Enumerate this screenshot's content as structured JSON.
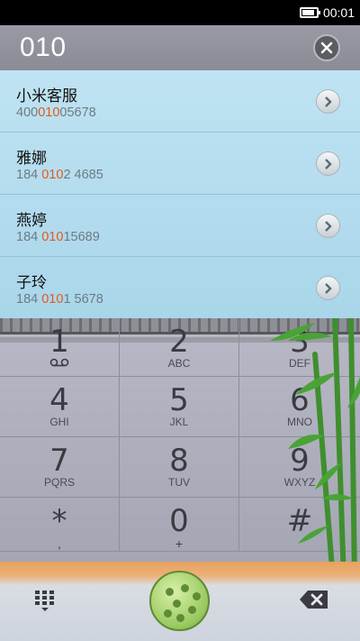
{
  "status_bar": {
    "time": "00:01",
    "battery_percent": 70
  },
  "search": {
    "query": "010"
  },
  "results": [
    {
      "name": "小米客服",
      "number_pre": "400",
      "number_hl": "010",
      "number_post": "05678"
    },
    {
      "name": "雅娜",
      "number_pre": "184 ",
      "number_hl": "010",
      "number_post": "2 4685"
    },
    {
      "name": "燕婷",
      "number_pre": "184 ",
      "number_hl": "010",
      "number_post": "15689"
    },
    {
      "name": "子玲",
      "number_pre": "184 ",
      "number_hl": "010",
      "number_post": "1 5678"
    }
  ],
  "dialpad": {
    "keys": [
      {
        "digit": "1",
        "letters": ""
      },
      {
        "digit": "2",
        "letters": "ABC"
      },
      {
        "digit": "3",
        "letters": "DEF"
      },
      {
        "digit": "4",
        "letters": "GHI"
      },
      {
        "digit": "5",
        "letters": "JKL"
      },
      {
        "digit": "6",
        "letters": "MNO"
      },
      {
        "digit": "7",
        "letters": "PQRS"
      },
      {
        "digit": "8",
        "letters": "TUV"
      },
      {
        "digit": "9",
        "letters": "WXYZ"
      },
      {
        "digit": "*",
        "letters": ","
      },
      {
        "digit": "0",
        "letters": "+"
      },
      {
        "digit": "#",
        "letters": ""
      }
    ]
  },
  "colors": {
    "highlight": "#e25a1c",
    "list_bg": "#bfe3f2",
    "call_green": "#97c75e"
  },
  "icons": {
    "clear": "close-icon",
    "detail": "chevron-right-icon",
    "voicemail": "voicemail-icon",
    "grid": "dialpad-grid-icon",
    "call": "call-icon",
    "backspace": "backspace-icon"
  }
}
